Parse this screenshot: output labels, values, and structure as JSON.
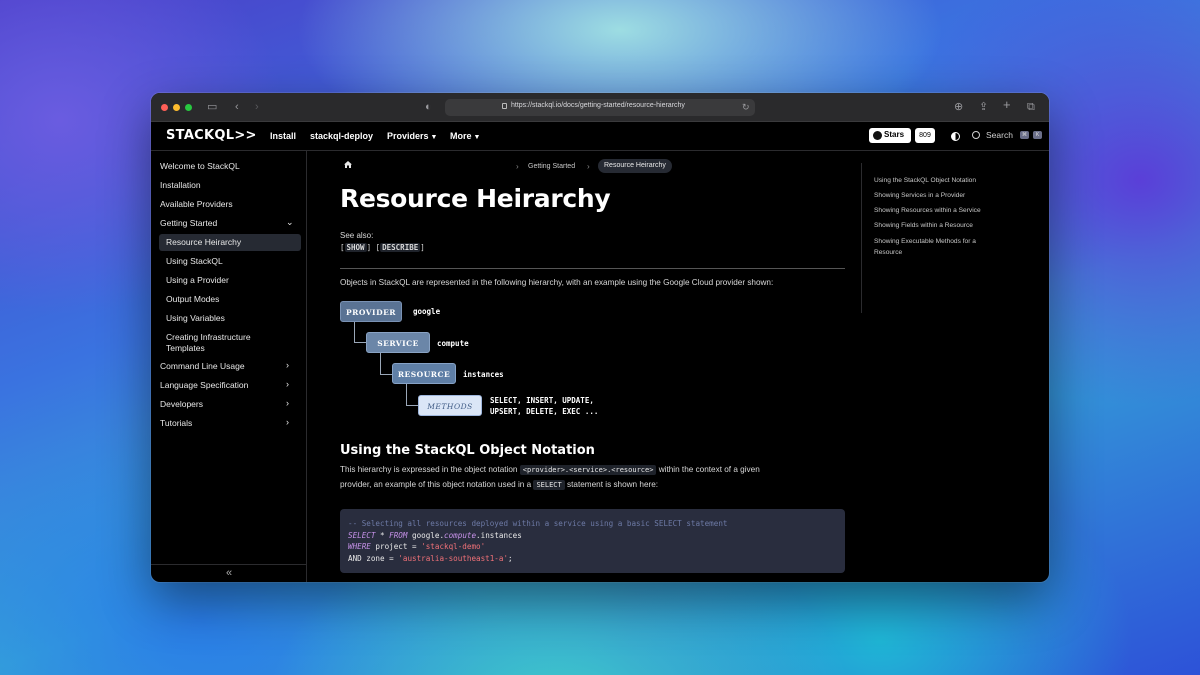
{
  "browser": {
    "url": "https://stackql.io/docs/getting-started/resource-hierarchy"
  },
  "nav": {
    "logo": "STACKQL>>",
    "links": [
      "Install",
      "stackql-deploy",
      "Providers",
      "More"
    ],
    "github_label": "Stars",
    "github_count": "809",
    "search_label": "Search",
    "kbd_keys": [
      "⌘",
      "K"
    ]
  },
  "sidebar": {
    "items": [
      {
        "label": "Welcome to StackQL"
      },
      {
        "label": "Installation"
      },
      {
        "label": "Available Providers"
      },
      {
        "label": "Getting Started",
        "expanded": true
      },
      {
        "label": "Resource Heirarchy",
        "active": true
      },
      {
        "label": "Using StackQL"
      },
      {
        "label": "Using a Provider"
      },
      {
        "label": "Output Modes"
      },
      {
        "label": "Using Variables"
      },
      {
        "label": "Creating Infrastructure",
        "label2": "Templates"
      },
      {
        "label": "Command Line Usage"
      },
      {
        "label": "Language Specification"
      },
      {
        "label": "Developers"
      },
      {
        "label": "Tutorials"
      }
    ],
    "collapse_icon": "«"
  },
  "breadcrumb": {
    "items": [
      "Getting Started",
      "Resource Heirarchy"
    ]
  },
  "page": {
    "title": "Resource Heirarchy",
    "see_also": "See also:",
    "see_also_links": [
      "SHOW",
      "DESCRIBE"
    ],
    "intro": "Objects in StackQL are represented in the following hierarchy, with an example using the Google Cloud provider shown:",
    "hierarchy": [
      {
        "label": "PROVIDER",
        "value": "google",
        "color": "#5a7394"
      },
      {
        "label": "SERVICE",
        "value": "compute",
        "color": "#6b86a8"
      },
      {
        "label": "RESOURCE",
        "value": "instances",
        "color": "#5f7fa6"
      },
      {
        "label": "METHODS",
        "value": "SELECT, INSERT, UPDATE,",
        "value2": "UPSERT, DELETE, EXEC ...",
        "color": "#dbe6f7"
      }
    ],
    "section_heading": "Using the StackQL Object Notation",
    "notation_para_1a": "This hierarchy is expressed in the object notation",
    "notation_code": "<provider>.<service>.<resource>",
    "notation_para_1b": "within the context of a given",
    "notation_para_2a": "provider, an example of this object notation used in a",
    "notation_select": "SELECT",
    "notation_para_2b": "statement is shown here:",
    "code": {
      "comment": "-- Selecting all resources deployed within a service using a basic SELECT statement",
      "line2_kw1": "SELECT",
      "line2_mid": " * ",
      "line2_kw2": "FROM",
      "line2_a": " google.",
      "line2_b": "compute",
      "line2_c": ".instances",
      "line3_kw": "WHERE",
      "line3_a": " project = ",
      "line3_str": "'stackql-demo'",
      "line4_a": "AND zone = ",
      "line4_str": "'australia-southeast1-a'",
      "line4_end": ";"
    }
  },
  "toc": {
    "items": [
      "Using the StackQL Object Notation",
      "Showing Services in a Provider",
      "Showing Resources within a Service",
      "Showing Fields within a Resource",
      "Showing Executable Methods for a Resource"
    ]
  },
  "colors": {
    "accent_active": "#262a33",
    "code_bg": "#292d3e"
  }
}
